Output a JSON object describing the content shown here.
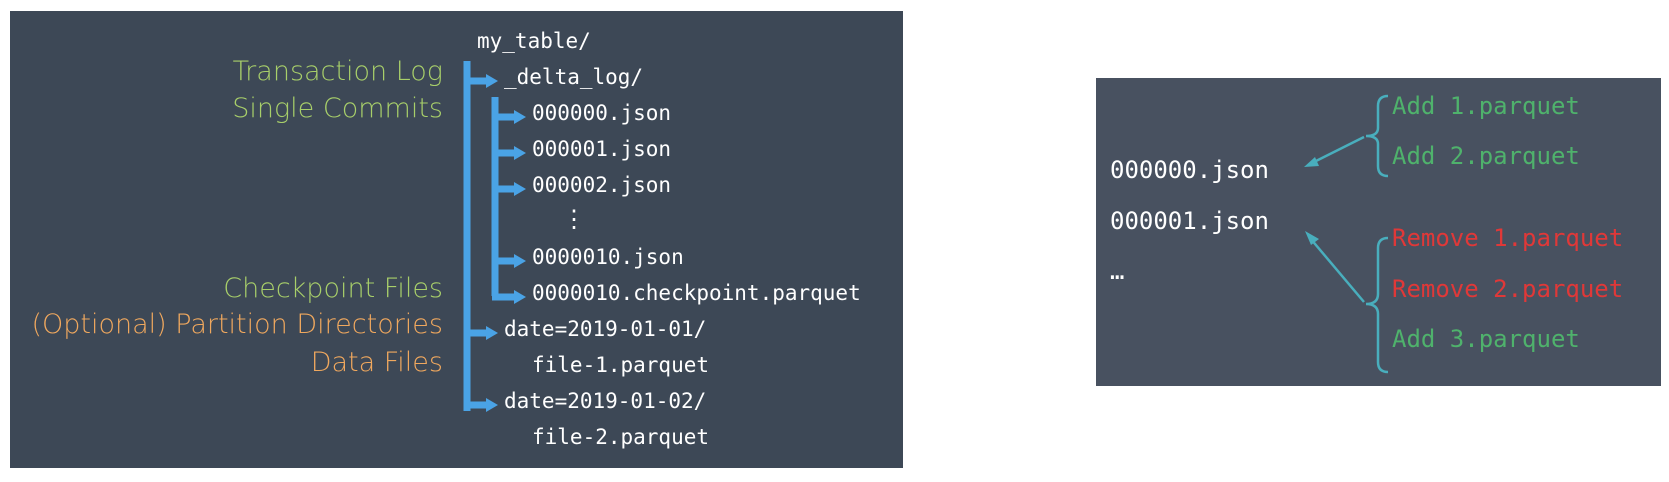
{
  "left": {
    "labels": {
      "transaction_log": "Transaction Log",
      "single_commits": "Single Commits",
      "checkpoint_files": "Checkpoint Files",
      "partition_directories": "(Optional) Partition Directories",
      "data_files": "Data Files"
    },
    "tree": {
      "root": "my_table/",
      "delta_log": "_delta_log/",
      "commit_0": "000000.json",
      "commit_1": "000001.json",
      "commit_2": "000002.json",
      "ellipsis": "⋮",
      "commit_10": "0000010.json",
      "checkpoint": "0000010.checkpoint.parquet",
      "partition_1": "date=2019-01-01/",
      "file_1": "file-1.parquet",
      "partition_2": "date=2019-01-02/",
      "file_2": "file-2.parquet"
    }
  },
  "right": {
    "commit_0": "000000.json",
    "commit_1": "000001.json",
    "more": "…",
    "actions_0": [
      "Add 1.parquet",
      "Add 2.parquet"
    ],
    "actions_1": [
      "Remove 1.parquet",
      "Remove 2.parquet",
      "Add 3.parquet"
    ]
  },
  "colors": {
    "panel_left": "#3d4856",
    "panel_right": "#485160",
    "label_green": "#a8cf6a",
    "label_orange": "#f0a85e",
    "tree_arrow": "#4aa3e6",
    "add_green": "#4fb26c",
    "remove_red": "#e03838",
    "brace_teal": "#49aebd"
  }
}
